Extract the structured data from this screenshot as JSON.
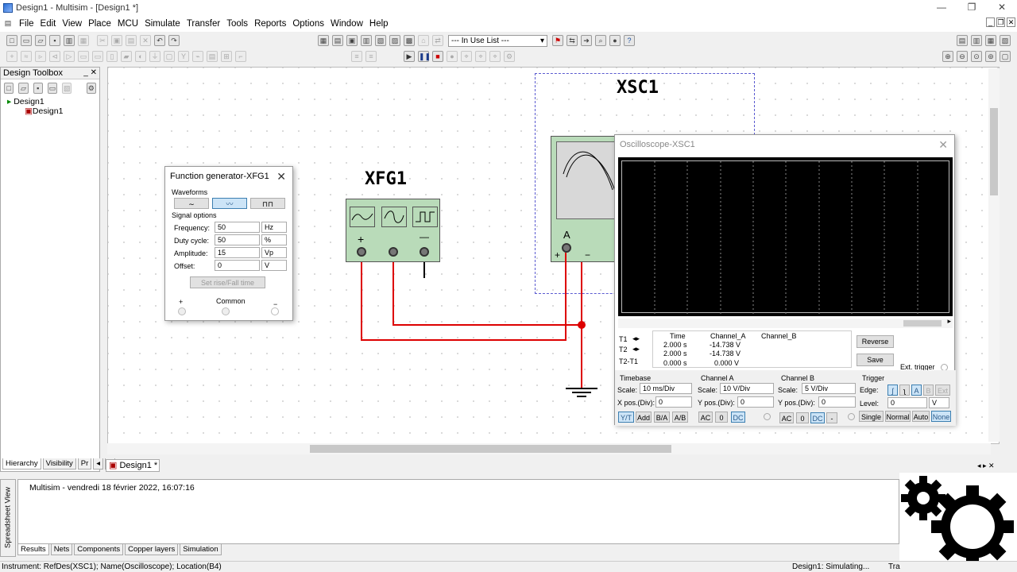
{
  "window": {
    "title": "Design1 - Multisim - [Design1 *]"
  },
  "menu": [
    "File",
    "Edit",
    "View",
    "Place",
    "MCU",
    "Simulate",
    "Transfer",
    "Tools",
    "Reports",
    "Options",
    "Window",
    "Help"
  ],
  "toolbar": {
    "in_use_list": "--- In Use List ---"
  },
  "toolbox": {
    "title": "Design Toolbox",
    "root": "Design1",
    "child": "Design1",
    "tabs": [
      "Hierarchy",
      "Visibility",
      "Pr"
    ]
  },
  "canvas": {
    "xsc_label": "XSC1",
    "xfg_label": "XFG1",
    "scope_channel_a": "A",
    "scope_plus": "+",
    "scope_minus": "−",
    "xfg_plus": "+",
    "xfg_minus": "—"
  },
  "fgen": {
    "title": "Function generator-XFG1",
    "waveforms_label": "Waveforms",
    "signal_options_label": "Signal options",
    "rows": [
      {
        "label": "Frequency:",
        "value": "50",
        "unit": "Hz"
      },
      {
        "label": "Duty cycle:",
        "value": "50",
        "unit": "%"
      },
      {
        "label": "Amplitude:",
        "value": "15",
        "unit": "Vp"
      },
      {
        "label": "Offset:",
        "value": "0",
        "unit": "V"
      }
    ],
    "rise_fall": "Set rise/Fall time",
    "plus": "+",
    "common": "Common",
    "minus": "−"
  },
  "scope": {
    "title": "Oscilloscope-XSC1",
    "cursor_headers": [
      "Time",
      "Channel_A",
      "Channel_B"
    ],
    "cursor_rows": [
      {
        "label": "T1",
        "time": "2.000 s",
        "cha": "-14.738 V",
        "chb": ""
      },
      {
        "label": "T2",
        "time": "2.000 s",
        "cha": "-14.738 V",
        "chb": ""
      },
      {
        "label": "T2-T1",
        "time": "0.000 s",
        "cha": "0.000 V",
        "chb": ""
      }
    ],
    "reverse": "Reverse",
    "save": "Save",
    "ext_trigger": "Ext. trigger",
    "timebase": {
      "title": "Timebase",
      "scale_label": "Scale:",
      "scale": "10 ms/Div",
      "xpos_label": "X pos.(Div):",
      "xpos": "0",
      "modes": [
        "Y/T",
        "Add",
        "B/A",
        "A/B"
      ]
    },
    "cha": {
      "title": "Channel A",
      "scale_label": "Scale:",
      "scale": "10  V/Div",
      "ypos_label": "Y pos.(Div):",
      "ypos": "0",
      "coupling": [
        "AC",
        "0",
        "DC"
      ]
    },
    "chb": {
      "title": "Channel B",
      "scale_label": "Scale:",
      "scale": "5  V/Div",
      "ypos_label": "Y pos.(Div):",
      "ypos": "0",
      "coupling": [
        "AC",
        "0",
        "DC",
        "-"
      ]
    },
    "trigger": {
      "title": "Trigger",
      "edge_label": "Edge:",
      "level_label": "Level:",
      "level": "0",
      "level_unit": "V",
      "edge_btns": [
        "A",
        "B",
        "Ext"
      ],
      "modes": [
        "Single",
        "Normal",
        "Auto",
        "None"
      ]
    }
  },
  "doc_tab": "Design1 *",
  "results": {
    "line": "Multisim  -  vendredi 18 février 2022, 16:07:16",
    "tabs": [
      "Results",
      "Nets",
      "Components",
      "Copper layers",
      "Simulation"
    ],
    "side": "Spreadsheet View"
  },
  "status": {
    "left": "Instrument: RefDes(XSC1); Name(Oscilloscope); Location(B4)",
    "middle": "Design1: Simulating...",
    "right": "Tra"
  }
}
